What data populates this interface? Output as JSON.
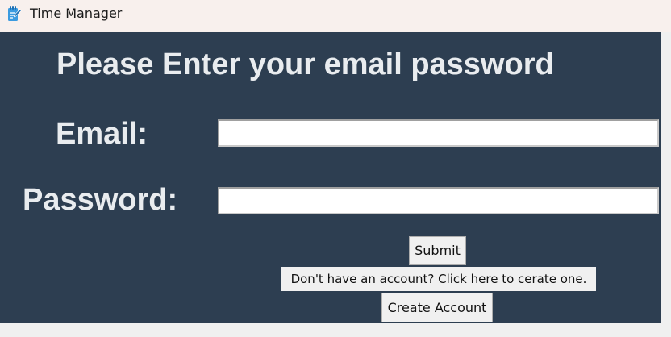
{
  "window": {
    "title": "Time Manager",
    "icon": "notepad-pencil-icon"
  },
  "form": {
    "heading": "Please Enter your email password",
    "email_label": "Email:",
    "email_value": "",
    "password_label": "Password:",
    "password_value": "",
    "submit_label": "Submit",
    "no_account_text": "Don't have an account? Click here to cerate one.",
    "create_account_label": "Create Account"
  },
  "colors": {
    "background": "#2d3e51",
    "label_text": "#e9ecef",
    "titlebar": "#f8f0ed",
    "button_face": "#f0f0f0"
  }
}
